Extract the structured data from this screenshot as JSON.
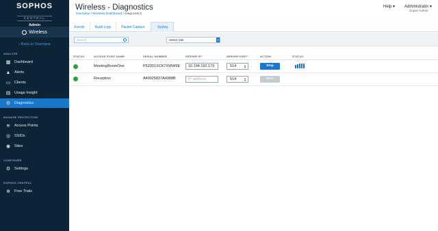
{
  "sidebar": {
    "brand": "SOPHOS",
    "brand_sub": "CENTRAL",
    "brand_role": "Admin",
    "product": "Wireless",
    "back_label": "Back to Overview",
    "sections": {
      "analyze": "ANALYZE",
      "manage": "MANAGE PROTECTION",
      "configure": "CONFIGURE",
      "central": "SOPHOS CENTRAL"
    },
    "items": {
      "dashboard": "Dashboard",
      "alerts": "Alerts",
      "clients": "Clients",
      "usage": "Usage Insight",
      "diagnostics": "Diagnostics",
      "access_points": "Access Points",
      "ssids": "SSIDs",
      "sites": "Sites",
      "settings": "Settings",
      "free_trials": "Free Trials"
    }
  },
  "header": {
    "title": "Wireless - Diagnostics",
    "breadcrumb": [
      "Overview",
      "Wireless Dashboard",
      "Diagnostics"
    ],
    "help": "Help",
    "user": "Administrator",
    "role": "Super Admin"
  },
  "tabs": [
    "Events",
    "Audit Logs",
    "Packet Capture",
    "Syslog"
  ],
  "active_tab": "Syslog",
  "filters": {
    "search_placeholder": "Search",
    "site_select": "Select Site"
  },
  "table": {
    "columns": {
      "status": "STATUS",
      "ap_name": "ACCESS POINT NAME",
      "serial": "SERIAL NUMBER",
      "server_ip": "SERVER IP",
      "server_port": "SERVER PORT",
      "action": "ACTION",
      "status2": "STATUS"
    },
    "required_mark": "*",
    "rows": [
      {
        "name": "MeetingRoomOne",
        "serial": "P52001XCK7XWW9E",
        "ip": "10.194.192.173",
        "port": "514",
        "action": "Stop"
      },
      {
        "name": "Reception",
        "serial": "A40025837A4988B",
        "ip_placeholder": "IP address",
        "port": "514",
        "action": "Start"
      }
    ]
  },
  "colors": {
    "sidebar_bg": "#0d2437",
    "accent": "#1a77c9",
    "online": "#2aa33a"
  }
}
